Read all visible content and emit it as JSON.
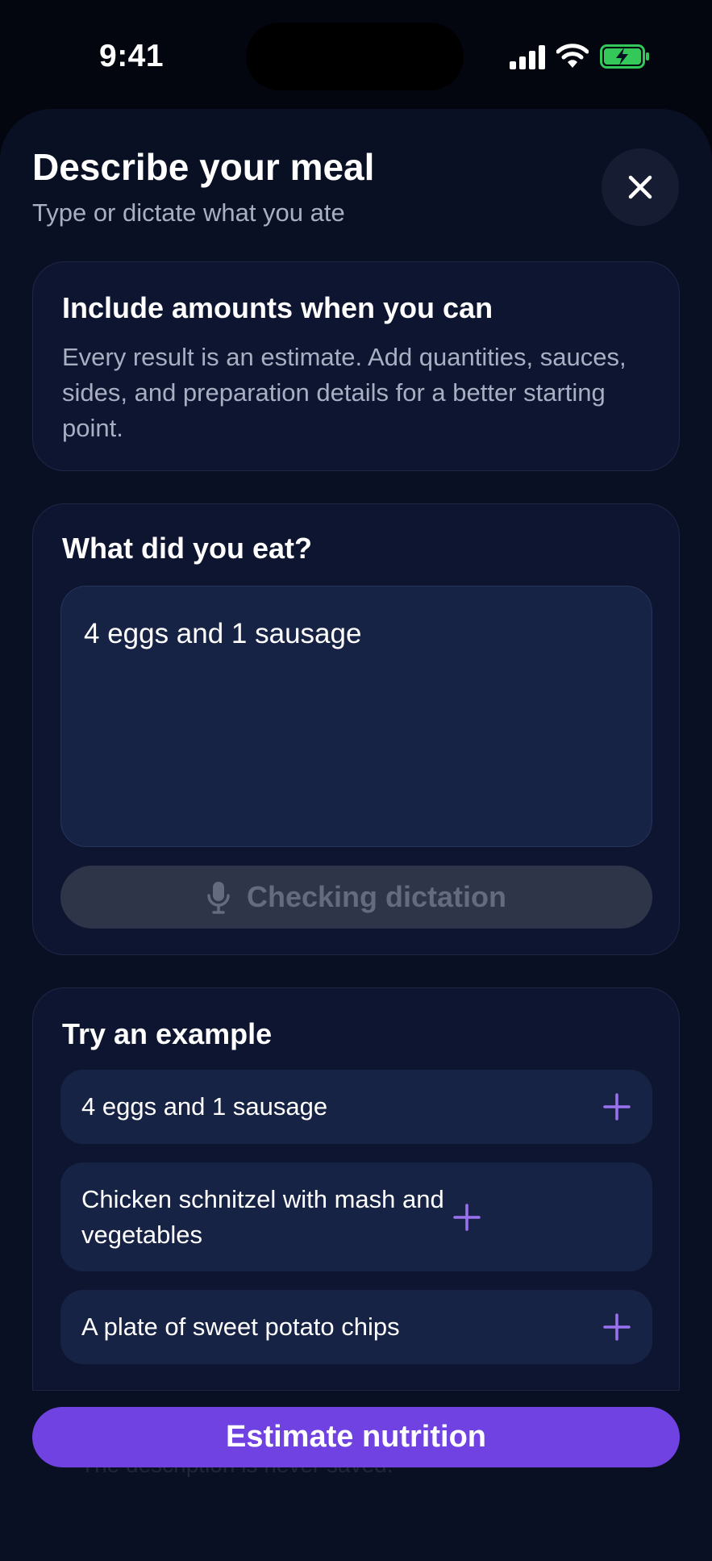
{
  "status": {
    "time": "9:41"
  },
  "header": {
    "title": "Describe your meal",
    "subtitle": "Type or dictate what you ate"
  },
  "tip": {
    "title": "Include amounts when you can",
    "body": "Every result is an estimate. Add quantities, sauces, sides, and preparation details for a better starting point."
  },
  "input": {
    "label": "What did you eat?",
    "value": "4 eggs and 1 sausage",
    "dictation_label": "Checking dictation"
  },
  "examples": {
    "title": "Try an example",
    "items": [
      {
        "label": "4 eggs and 1 sausage"
      },
      {
        "label": "Chicken schnitzel with mash and vegetables"
      },
      {
        "label": "A plate of sweet potato chips"
      }
    ]
  },
  "footer": {
    "cta_label": "Estimate nutrition",
    "obscured_note": "The description is never saved."
  },
  "colors": {
    "accent": "#6f42e1",
    "plus": "#9a72f0",
    "battery": "#34c759"
  }
}
